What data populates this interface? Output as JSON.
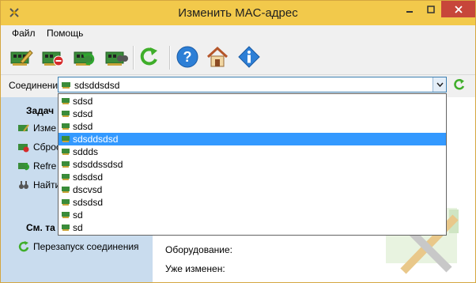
{
  "window": {
    "title": "Изменить MAC-адрес"
  },
  "menu": {
    "items": [
      "Файл",
      "Помощь"
    ]
  },
  "connection": {
    "label": "Соединение",
    "value": "sdsddsdsd",
    "options": [
      "sdsd",
      "sdsd",
      "sdsd",
      "sdsddsdsd",
      "sddds",
      "sdsddssdsd",
      "sdsdsd",
      "dscvsd",
      "sdsdsd",
      "sd",
      "sd"
    ],
    "selected_index": 3
  },
  "tasks": {
    "heading": "Задач",
    "items": [
      "Изме",
      "Сброс",
      "Refre",
      "Найти"
    ]
  },
  "see_also": {
    "heading": "См. та",
    "items": [
      "Перезапуск соединения"
    ]
  },
  "details": {
    "hardware_label": "Оборудование:",
    "changed_label": "Уже изменен:"
  },
  "colors": {
    "titlebar": "#f2c94b",
    "close": "#c7463a",
    "panel": "#c9dcee",
    "selection": "#3399ff"
  },
  "icons": [
    "app-icon",
    "edit-nic-icon",
    "reset-nic-icon",
    "refresh-nic-icon",
    "search-nic-icon",
    "refresh-icon",
    "help-icon",
    "home-icon",
    "info-icon"
  ]
}
